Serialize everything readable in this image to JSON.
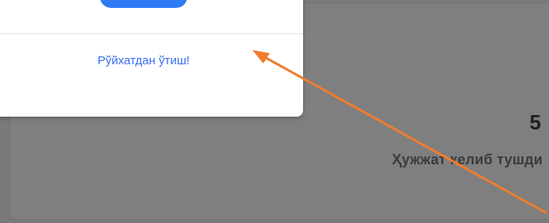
{
  "stat_card": {
    "value": "5",
    "label": "Ҳужжат келиб тушди"
  },
  "modal": {
    "primary_button_label": "",
    "register_link": "Рўйхатдан ўтиш!"
  },
  "colors": {
    "overlay": "#7a7a7a",
    "link": "#3a6ef0",
    "primary_button": "#2f7bf5",
    "arrow": "#ef7d2d"
  },
  "icons": {
    "annotation": "arrow-icon"
  }
}
